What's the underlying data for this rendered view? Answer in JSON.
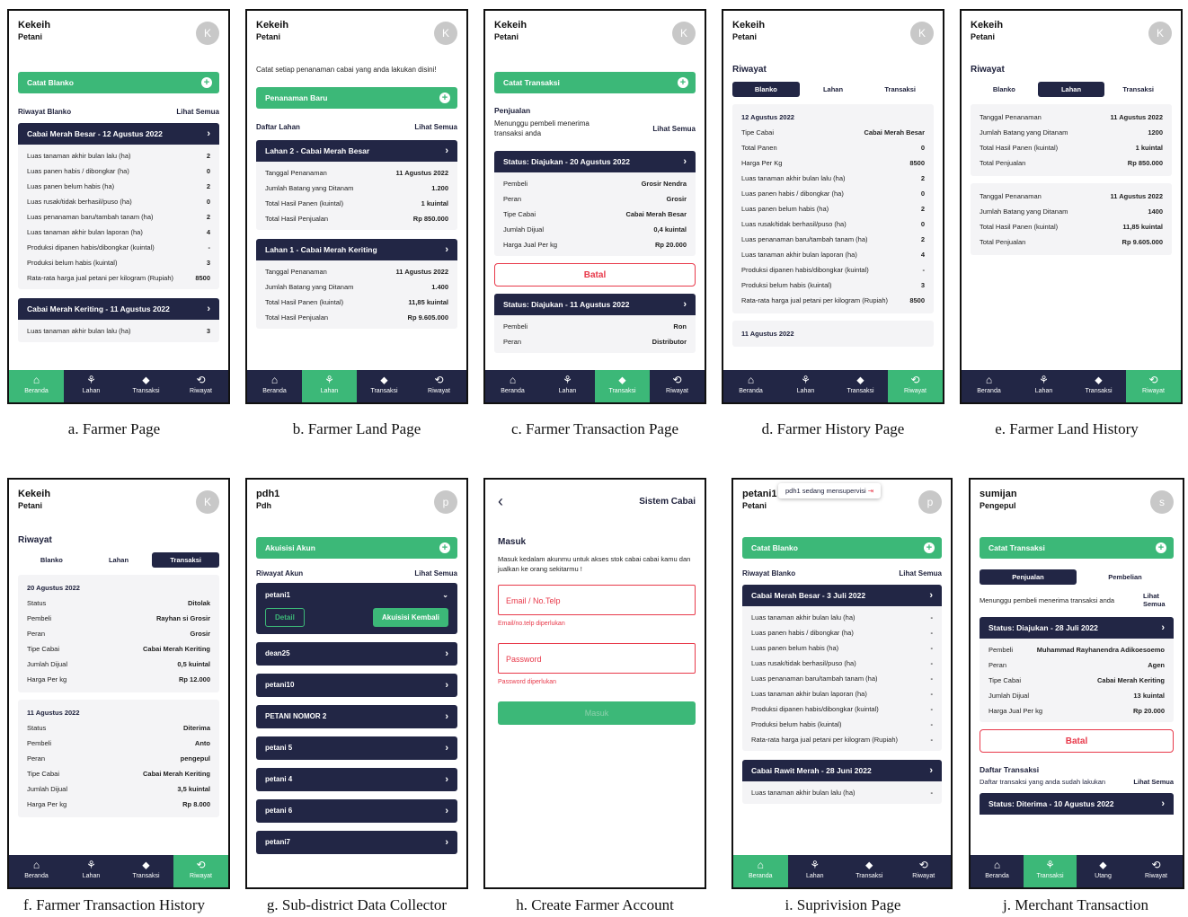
{
  "nav": [
    "Beranda",
    "Lahan",
    "Transaksi",
    "Riwayat"
  ],
  "merchant_nav": [
    "Beranda",
    "Transaksi",
    "Utang",
    "Riwayat"
  ],
  "captions": [
    "a. Farmer Page",
    "b. Farmer Land Page",
    "c. Farmer Transaction Page",
    "d. Farmer History Page",
    "e. Farmer Land History",
    "f. Farmer Transaction History",
    "g. Sub-district Data Collector",
    "h. Create Farmer Account",
    "i. Suprivision Page",
    "j. Merchant Transaction"
  ],
  "farmer": {
    "name": "Kekeih",
    "role": "Petani",
    "initial": "K"
  },
  "blanko_labels": [
    "Luas tanaman akhir bulan lalu (ha)",
    "Luas panen habis / dibongkar (ha)",
    "Luas panen belum habis (ha)",
    "Luas rusak/tidak berhasil/puso (ha)",
    "Luas penanaman baru/tambah tanam (ha)",
    "Luas tanaman akhir bulan laporan (ha)",
    "Produksi dipanen habis/dibongkar (kuintal)",
    "Produksi belum habis (kuintal)",
    "Rata-rata harga jual petani per kilogram (Rupiah)"
  ],
  "blanko_values": [
    "2",
    "0",
    "2",
    "0",
    "2",
    "4",
    "-",
    "3",
    "8500"
  ],
  "a": {
    "btn": "Catat Blanko",
    "sec": "Riwayat Blanko",
    "see": "Lihat Semua",
    "card1": "Cabai Merah Besar - 12 Agustus 2022",
    "card2": "Cabai Merah Keriting - 11 Agustus 2022",
    "card2_row": "Luas tanaman akhir bulan lalu (ha)",
    "card2_val": "3"
  },
  "b": {
    "intro": "Catat setiap penanaman cabai yang anda lakukan disini!",
    "btn": "Penanaman Baru",
    "sec": "Daftar Lahan",
    "see": "Lihat Semua",
    "lands": [
      {
        "title": "Lahan 2 - Cabai Merah Besar",
        "rows": [
          [
            "Tanggal Penanaman",
            "11 Agustus 2022"
          ],
          [
            "Jumlah Batang yang Ditanam",
            "1.200"
          ],
          [
            "Total Hasil Panen (kuintal)",
            "1 kuintal"
          ],
          [
            "Total Hasil Penjualan",
            "Rp 850.000"
          ]
        ]
      },
      {
        "title": "Lahan 1 - Cabai Merah Keriting",
        "rows": [
          [
            "Tanggal Penanaman",
            "11 Agustus 2022"
          ],
          [
            "Jumlah Batang yang Ditanam",
            "1.400"
          ],
          [
            "Total Hasil Panen (kuintal)",
            "11,85 kuintal"
          ],
          [
            "Total Hasil Penjualan",
            "Rp 9.605.000"
          ]
        ]
      }
    ]
  },
  "c": {
    "btn": "Catat Transaksi",
    "sec": "Penjualan",
    "desc": "Menunggu pembeli menerima transaksi anda",
    "see": "Lihat Semua",
    "t1": "Status: Diajukan - 20 Agustus 2022",
    "t1rows": [
      [
        "Pembeli",
        "Grosir Nendra"
      ],
      [
        "Peran",
        "Grosir"
      ],
      [
        "Tipe Cabai",
        "Cabai Merah Besar"
      ],
      [
        "Jumlah Dijual",
        "0,4 kuintal"
      ],
      [
        "Harga Jual Per kg",
        "Rp 20.000"
      ]
    ],
    "cancel": "Batal",
    "t2": "Status: Diajukan - 11 Agustus 2022",
    "t2rows": [
      [
        "Pembeli",
        "Ron"
      ],
      [
        "Peran",
        "Distributor"
      ]
    ]
  },
  "d": {
    "title": "Riwayat",
    "tabs": [
      "Blanko",
      "Lahan",
      "Transaksi"
    ],
    "date": "12 Agustus 2022",
    "pre": [
      [
        "Tipe Cabai",
        "Cabai Merah Besar"
      ],
      [
        "Total Panen",
        "0"
      ],
      [
        "Harga Per Kg",
        "8500"
      ]
    ],
    "date2": "11 Agustus 2022"
  },
  "e": {
    "title": "Riwayat",
    "tabs": [
      "Blanko",
      "Lahan",
      "Transaksi"
    ],
    "cards": [
      [
        [
          "Tanggal Penanaman",
          "11 Agustus 2022"
        ],
        [
          "Jumlah Batang yang Ditanam",
          "1200"
        ],
        [
          "Total Hasil Panen (kuintal)",
          "1 kuintal"
        ],
        [
          "Total Penjualan",
          "Rp 850.000"
        ]
      ],
      [
        [
          "Tanggal Penanaman",
          "11 Agustus 2022"
        ],
        [
          "Jumlah Batang yang Ditanam",
          "1400"
        ],
        [
          "Total Hasil Panen (kuintal)",
          "11,85 kuintal"
        ],
        [
          "Total Penjualan",
          "Rp 9.605.000"
        ]
      ]
    ]
  },
  "f": {
    "title": "Riwayat",
    "tabs": [
      "Blanko",
      "Lahan",
      "Transaksi"
    ],
    "h1date": "20 Agustus 2022",
    "h1": [
      [
        "Status",
        "Ditolak"
      ],
      [
        "Pembeli",
        "Rayhan si Grosir"
      ],
      [
        "Peran",
        "Grosir"
      ],
      [
        "Tipe Cabai",
        "Cabai Merah Keriting"
      ],
      [
        "Jumlah Dijual",
        "0,5 kuintal"
      ],
      [
        "Harga Per kg",
        "Rp 12.000"
      ]
    ],
    "h2date": "11 Agustus 2022",
    "h2": [
      [
        "Status",
        "Diterima"
      ],
      [
        "Pembeli",
        "Anto"
      ],
      [
        "Peran",
        "pengepul"
      ],
      [
        "Tipe Cabai",
        "Cabai Merah Keriting"
      ],
      [
        "Jumlah Dijual",
        "3,5 kuintal"
      ],
      [
        "Harga Per kg",
        "Rp 8.000"
      ]
    ]
  },
  "g": {
    "name": "pdh1",
    "role": "Pdh",
    "initial": "p",
    "btn": "Akuisisi Akun",
    "sec": "Riwayat Akun",
    "see": "Lihat Semua",
    "open": "petani1",
    "detail": "Detail",
    "reacq": "Akuisisi Kembali",
    "accounts": [
      "dean25",
      "petani10",
      "PETANI NOMOR 2",
      "petani 5",
      "petani 4",
      "petani 6",
      "petani7"
    ]
  },
  "h": {
    "title": "Sistem Cabai",
    "heading": "Masuk",
    "desc": "Masuk kedalam akunmu untuk akses stok cabai cabai kamu dan jualkan ke orang sekitarmu !",
    "email": "Email / No.Telp",
    "email_err": "Email/no.telp diperlukan",
    "pass": "Password",
    "pass_err": "Password diperlukan",
    "submit": "Masuk"
  },
  "i": {
    "name": "petani1",
    "role": "Petani",
    "initial": "p",
    "toast": "pdh1 sedang mensupervisi",
    "btn": "Catat Blanko",
    "sec": "Riwayat Blanko",
    "see": "Lihat Semua",
    "card1": "Cabai Merah Besar - 3 Juli 2022",
    "card2": "Cabai Rawit Merah - 28 Juni 2022",
    "card2_row": "Luas tanaman akhir bulan lalu (ha)",
    "dash": "-"
  },
  "j": {
    "name": "sumijan",
    "role": "Pengepul",
    "initial": "s",
    "btn": "Catat Transaksi",
    "tabs": [
      "Penjualan",
      "Pembelian"
    ],
    "desc": "Menunggu pembeli menerima transaksi anda",
    "see": "Lihat Semua",
    "status": "Status: Diajukan - 28 Juli 2022",
    "rows": [
      [
        "Pembeli",
        "Muhammad Rayhanendra Adikoesoemo"
      ],
      [
        "Peran",
        "Agen"
      ],
      [
        "Tipe Cabai",
        "Cabai Merah Keriting"
      ],
      [
        "Jumlah Dijual",
        "13 kuintal"
      ],
      [
        "Harga Jual Per kg",
        "Rp 20.000"
      ]
    ],
    "cancel": "Batal",
    "list": "Daftar Transaksi",
    "list_desc": "Daftar transaksi yang anda sudah lakukan",
    "status2": "Status: Diterima - 10 Agustus 2022"
  }
}
